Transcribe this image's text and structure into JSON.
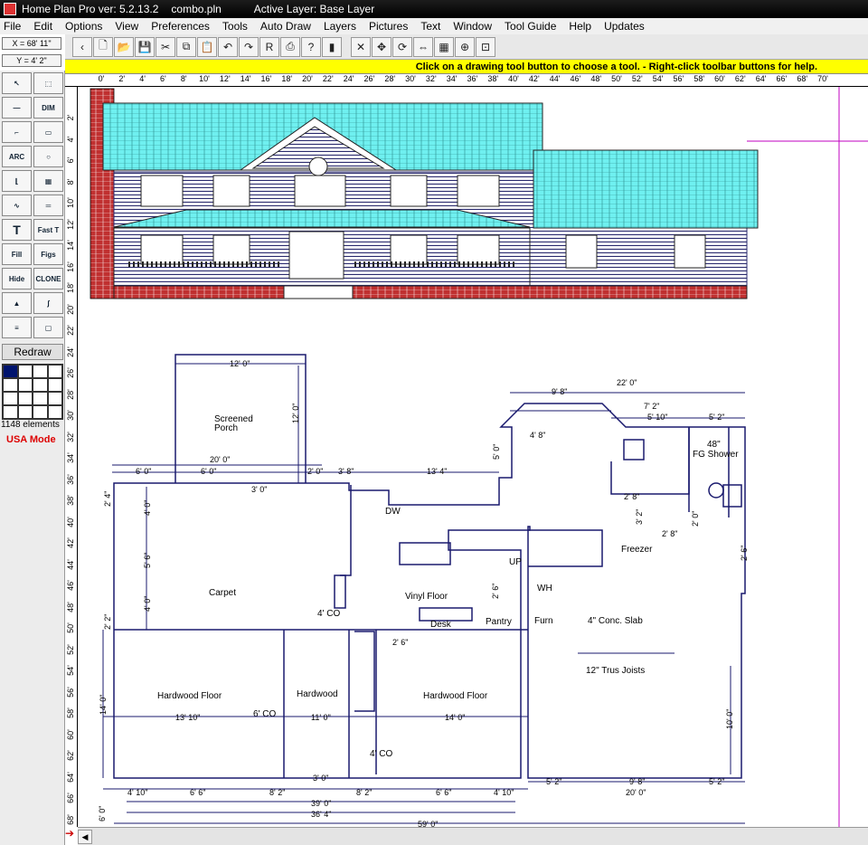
{
  "window": {
    "app_title": "Home Plan Pro ver: 5.2.13.2",
    "file_name": "combo.pln",
    "active_layer": "Active Layer: Base Layer"
  },
  "menu": [
    "File",
    "Edit",
    "Options",
    "View",
    "Preferences",
    "Tools",
    "Auto Draw",
    "Layers",
    "Pictures",
    "Text",
    "Window",
    "Tool Guide",
    "Help",
    "Updates"
  ],
  "coords": {
    "x": "X = 68' 11\"",
    "y": "Y = 4' 2\""
  },
  "toolbar_hint": "Click on a drawing tool button to choose a tool.  -  Right-click toolbar buttons for help.",
  "toolbar_icons": [
    "chevron-left-icon",
    "new-icon",
    "open-icon",
    "save-icon",
    "cut-icon",
    "copy-icon",
    "paste-icon",
    "undo-icon",
    "redo-icon",
    "print-preview-icon",
    "print-icon",
    "help-icon",
    "close-book-icon",
    "delete-icon",
    "move-icon",
    "rotate-icon",
    "mirror-icon",
    "grid-icon",
    "zoom-icon",
    "fit-icon"
  ],
  "palette": {
    "tools": [
      "select-arrow",
      "select-box",
      "line",
      "DIM",
      "wall",
      "rectangle",
      "ARC",
      "circle",
      "corner",
      "grid",
      "curve",
      "double-line",
      "T",
      "Fast T",
      "Fill",
      "Figs",
      "Hide",
      "CLONE",
      "picture",
      "spline",
      "parallel",
      "box"
    ],
    "redraw_label": "Redraw",
    "elements_count": "1148 elements",
    "mode": "USA Mode"
  },
  "ruler_top": [
    "0'",
    "2'",
    "4'",
    "6'",
    "8'",
    "10'",
    "12'",
    "14'",
    "16'",
    "18'",
    "20'",
    "22'",
    "24'",
    "26'",
    "28'",
    "30'",
    "32'",
    "34'",
    "36'",
    "38'",
    "40'",
    "42'",
    "44'",
    "46'",
    "48'",
    "50'",
    "52'",
    "54'",
    "56'",
    "58'",
    "60'",
    "62'",
    "64'",
    "66'",
    "68'",
    "70'"
  ],
  "ruler_left": [
    "2'",
    "4'",
    "6'",
    "8'",
    "10'",
    "12'",
    "14'",
    "16'",
    "18'",
    "20'",
    "22'",
    "24'",
    "26'",
    "28'",
    "30'",
    "32'",
    "34'",
    "36'",
    "38'",
    "40'",
    "42'",
    "44'",
    "46'",
    "48'",
    "50'",
    "52'",
    "54'",
    "56'",
    "58'",
    "60'",
    "62'",
    "64'",
    "66'",
    "68'"
  ],
  "plan_labels": {
    "screened_porch": "Screened",
    "screened_porch2": "Porch",
    "carpet": "Carpet",
    "vinyl": "Vinyl Floor",
    "hardwood1": "Hardwood Floor",
    "hardwood2": "Hardwood",
    "hardwood3": "Hardwood Floor",
    "dw": "DW",
    "desk": "Desk",
    "pantry": "Pantry",
    "furn": "Furn",
    "wh": "WH",
    "up": "UP",
    "freezer": "Freezer",
    "slab": "4\" Conc. Slab",
    "joists": "12\" Trus Joists",
    "shower": "48\"",
    "shower2": "FG Shower",
    "co1": "4' CO",
    "co2": "6' CO",
    "co3": "4' CO"
  },
  "dimensions": {
    "d1": "12' 0\"",
    "d2": "12' 0\"",
    "d3": "20' 0\"",
    "d4": "6' 0\"",
    "d5": "6' 0\"",
    "d6": "2' 0\"",
    "d7": "3' 8\"",
    "d8": "13' 4\"",
    "d9": "5' 0\"",
    "d10": "9' 8\"",
    "d11": "22' 0\"",
    "d12": "7' 2\"",
    "d13": "5' 10\"",
    "d14": "5' 2\"",
    "d15": "4' 8\"",
    "d16": "3' 0\"",
    "d17": "2' 4\"",
    "d18": "4' 0\"",
    "d19": "5' 6\"",
    "d20": "4' 0\"",
    "d21": "2' 2\"",
    "d22": "2' 8\"",
    "d23": "3' 2\"",
    "d24": "2' 0\"",
    "d25": "2' 8\"",
    "d26": "2' 6\"",
    "d27": "2' 6\"",
    "d28": "2' 6\"",
    "d29": "14' 0\"",
    "d30": "13' 10\"",
    "d31": "11' 0\"",
    "d32": "14' 0\"",
    "d33": "10' 0\"",
    "d34": "3' 0\"",
    "d35": "4' 10\"",
    "d36": "6' 6\"",
    "d37": "8' 2\"",
    "d38": "8' 2\"",
    "d39": "6' 6\"",
    "d40": "4' 10\"",
    "d41": "5' 2\"",
    "d42": "9' 8\"",
    "d43": "5' 2\"",
    "d44": "39' 0\"",
    "d45": "20' 0\"",
    "d46": "36' 4\"",
    "d47": "59' 0\"",
    "d48": "6' 0\""
  },
  "colors": {
    "roof": "#6ff0f0",
    "brick": "#c03030",
    "siding": "#2a2a6e",
    "plan_line": "#1a1a6e",
    "hint_bg": "#ffff00",
    "guide": "#c000c0"
  }
}
